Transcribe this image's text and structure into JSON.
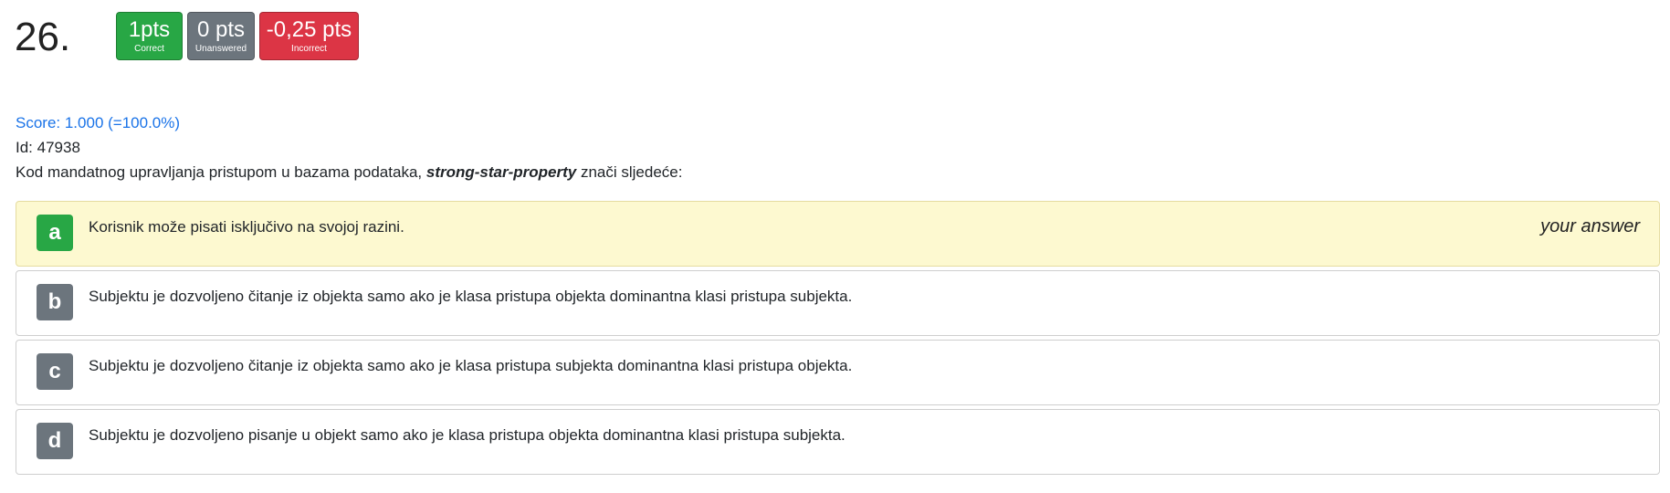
{
  "question": {
    "number": "26.",
    "score": "Score: 1.000 (=100.0%)",
    "id": "Id: 47938",
    "text_before": "Kod mandatnog upravljanja pristupom u bazama podataka, ",
    "text_emphasis": "strong-star-property",
    "text_after": " znači sljedeće:"
  },
  "badges": {
    "correct": {
      "pts": "1pts",
      "label": "Correct",
      "color": "#28a745"
    },
    "unanswered": {
      "pts": "0 pts",
      "label": "Unanswered",
      "color": "#6c757d"
    },
    "incorrect": {
      "pts": "-0,25 pts",
      "label": "Incorrect",
      "color": "#dc3545"
    }
  },
  "answers": [
    {
      "letter": "a",
      "text": "Korisnik može pisati isključivo na svojoj razini.",
      "selected": true,
      "letter_color": "#28a745",
      "note": "your answer"
    },
    {
      "letter": "b",
      "text": "Subjektu je dozvoljeno čitanje iz objekta samo ako je klasa pristupa objekta dominantna klasi pristupa subjekta.",
      "selected": false,
      "letter_color": "#6c757d"
    },
    {
      "letter": "c",
      "text": "Subjektu je dozvoljeno čitanje iz objekta samo ako je klasa pristupa subjekta dominantna klasi pristupa objekta.",
      "selected": false,
      "letter_color": "#6c757d"
    },
    {
      "letter": "d",
      "text": "Subjektu je dozvoljeno pisanje u objekt samo ako je klasa pristupa objekta dominantna klasi pristupa subjekta.",
      "selected": false,
      "letter_color": "#6c757d"
    }
  ]
}
